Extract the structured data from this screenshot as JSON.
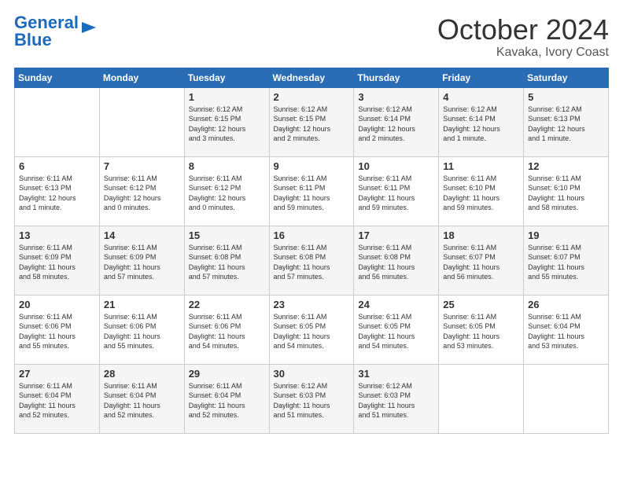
{
  "logo": {
    "line1": "General",
    "line2": "Blue"
  },
  "title": "October 2024",
  "subtitle": "Kavaka, Ivory Coast",
  "days_of_week": [
    "Sunday",
    "Monday",
    "Tuesday",
    "Wednesday",
    "Thursday",
    "Friday",
    "Saturday"
  ],
  "weeks": [
    [
      {
        "day": "",
        "detail": ""
      },
      {
        "day": "",
        "detail": ""
      },
      {
        "day": "1",
        "detail": "Sunrise: 6:12 AM\nSunset: 6:15 PM\nDaylight: 12 hours\nand 3 minutes."
      },
      {
        "day": "2",
        "detail": "Sunrise: 6:12 AM\nSunset: 6:15 PM\nDaylight: 12 hours\nand 2 minutes."
      },
      {
        "day": "3",
        "detail": "Sunrise: 6:12 AM\nSunset: 6:14 PM\nDaylight: 12 hours\nand 2 minutes."
      },
      {
        "day": "4",
        "detail": "Sunrise: 6:12 AM\nSunset: 6:14 PM\nDaylight: 12 hours\nand 1 minute."
      },
      {
        "day": "5",
        "detail": "Sunrise: 6:12 AM\nSunset: 6:13 PM\nDaylight: 12 hours\nand 1 minute."
      }
    ],
    [
      {
        "day": "6",
        "detail": "Sunrise: 6:11 AM\nSunset: 6:13 PM\nDaylight: 12 hours\nand 1 minute."
      },
      {
        "day": "7",
        "detail": "Sunrise: 6:11 AM\nSunset: 6:12 PM\nDaylight: 12 hours\nand 0 minutes."
      },
      {
        "day": "8",
        "detail": "Sunrise: 6:11 AM\nSunset: 6:12 PM\nDaylight: 12 hours\nand 0 minutes."
      },
      {
        "day": "9",
        "detail": "Sunrise: 6:11 AM\nSunset: 6:11 PM\nDaylight: 11 hours\nand 59 minutes."
      },
      {
        "day": "10",
        "detail": "Sunrise: 6:11 AM\nSunset: 6:11 PM\nDaylight: 11 hours\nand 59 minutes."
      },
      {
        "day": "11",
        "detail": "Sunrise: 6:11 AM\nSunset: 6:10 PM\nDaylight: 11 hours\nand 59 minutes."
      },
      {
        "day": "12",
        "detail": "Sunrise: 6:11 AM\nSunset: 6:10 PM\nDaylight: 11 hours\nand 58 minutes."
      }
    ],
    [
      {
        "day": "13",
        "detail": "Sunrise: 6:11 AM\nSunset: 6:09 PM\nDaylight: 11 hours\nand 58 minutes."
      },
      {
        "day": "14",
        "detail": "Sunrise: 6:11 AM\nSunset: 6:09 PM\nDaylight: 11 hours\nand 57 minutes."
      },
      {
        "day": "15",
        "detail": "Sunrise: 6:11 AM\nSunset: 6:08 PM\nDaylight: 11 hours\nand 57 minutes."
      },
      {
        "day": "16",
        "detail": "Sunrise: 6:11 AM\nSunset: 6:08 PM\nDaylight: 11 hours\nand 57 minutes."
      },
      {
        "day": "17",
        "detail": "Sunrise: 6:11 AM\nSunset: 6:08 PM\nDaylight: 11 hours\nand 56 minutes."
      },
      {
        "day": "18",
        "detail": "Sunrise: 6:11 AM\nSunset: 6:07 PM\nDaylight: 11 hours\nand 56 minutes."
      },
      {
        "day": "19",
        "detail": "Sunrise: 6:11 AM\nSunset: 6:07 PM\nDaylight: 11 hours\nand 55 minutes."
      }
    ],
    [
      {
        "day": "20",
        "detail": "Sunrise: 6:11 AM\nSunset: 6:06 PM\nDaylight: 11 hours\nand 55 minutes."
      },
      {
        "day": "21",
        "detail": "Sunrise: 6:11 AM\nSunset: 6:06 PM\nDaylight: 11 hours\nand 55 minutes."
      },
      {
        "day": "22",
        "detail": "Sunrise: 6:11 AM\nSunset: 6:06 PM\nDaylight: 11 hours\nand 54 minutes."
      },
      {
        "day": "23",
        "detail": "Sunrise: 6:11 AM\nSunset: 6:05 PM\nDaylight: 11 hours\nand 54 minutes."
      },
      {
        "day": "24",
        "detail": "Sunrise: 6:11 AM\nSunset: 6:05 PM\nDaylight: 11 hours\nand 54 minutes."
      },
      {
        "day": "25",
        "detail": "Sunrise: 6:11 AM\nSunset: 6:05 PM\nDaylight: 11 hours\nand 53 minutes."
      },
      {
        "day": "26",
        "detail": "Sunrise: 6:11 AM\nSunset: 6:04 PM\nDaylight: 11 hours\nand 53 minutes."
      }
    ],
    [
      {
        "day": "27",
        "detail": "Sunrise: 6:11 AM\nSunset: 6:04 PM\nDaylight: 11 hours\nand 52 minutes."
      },
      {
        "day": "28",
        "detail": "Sunrise: 6:11 AM\nSunset: 6:04 PM\nDaylight: 11 hours\nand 52 minutes."
      },
      {
        "day": "29",
        "detail": "Sunrise: 6:11 AM\nSunset: 6:04 PM\nDaylight: 11 hours\nand 52 minutes."
      },
      {
        "day": "30",
        "detail": "Sunrise: 6:12 AM\nSunset: 6:03 PM\nDaylight: 11 hours\nand 51 minutes."
      },
      {
        "day": "31",
        "detail": "Sunrise: 6:12 AM\nSunset: 6:03 PM\nDaylight: 11 hours\nand 51 minutes."
      },
      {
        "day": "",
        "detail": ""
      },
      {
        "day": "",
        "detail": ""
      }
    ]
  ]
}
